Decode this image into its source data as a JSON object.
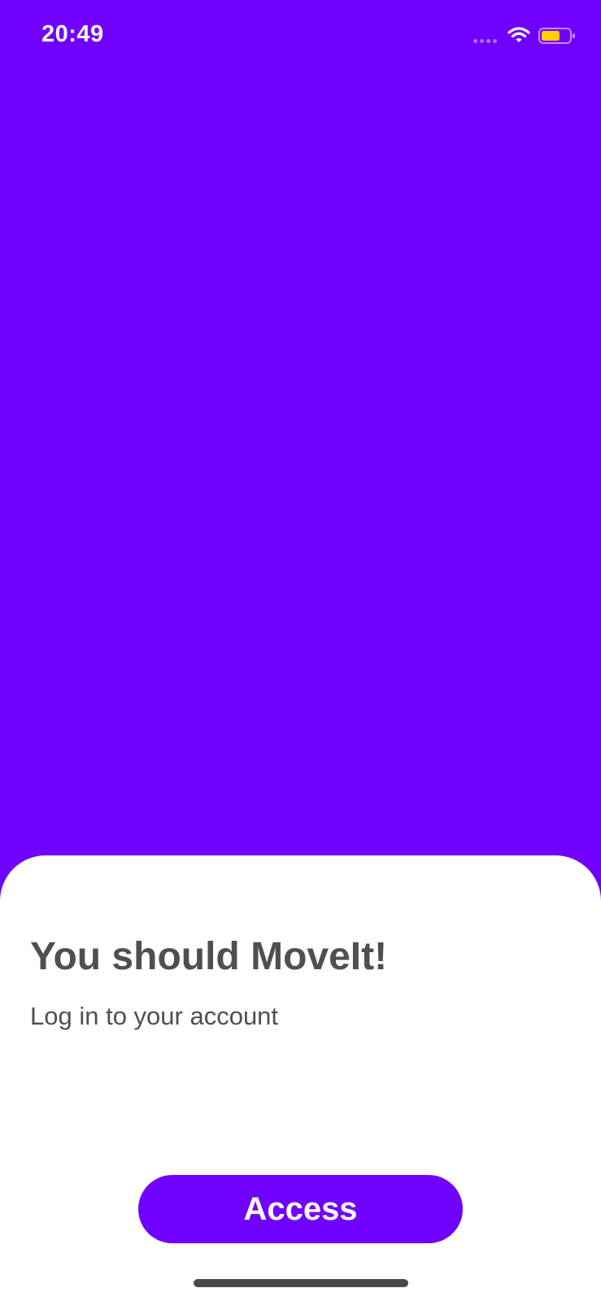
{
  "status_bar": {
    "time": "20:49",
    "icons": [
      "signal-icon",
      "wifi-icon",
      "battery-icon"
    ]
  },
  "colors": {
    "primary": "#7000FF",
    "sheet_background": "#ffffff",
    "text": "#4f4f4f",
    "battery_fill": "#FFCC00"
  },
  "sheet": {
    "title": "You should MoveIt!",
    "subtitle": "Log in to your account",
    "button_label": "Access"
  }
}
